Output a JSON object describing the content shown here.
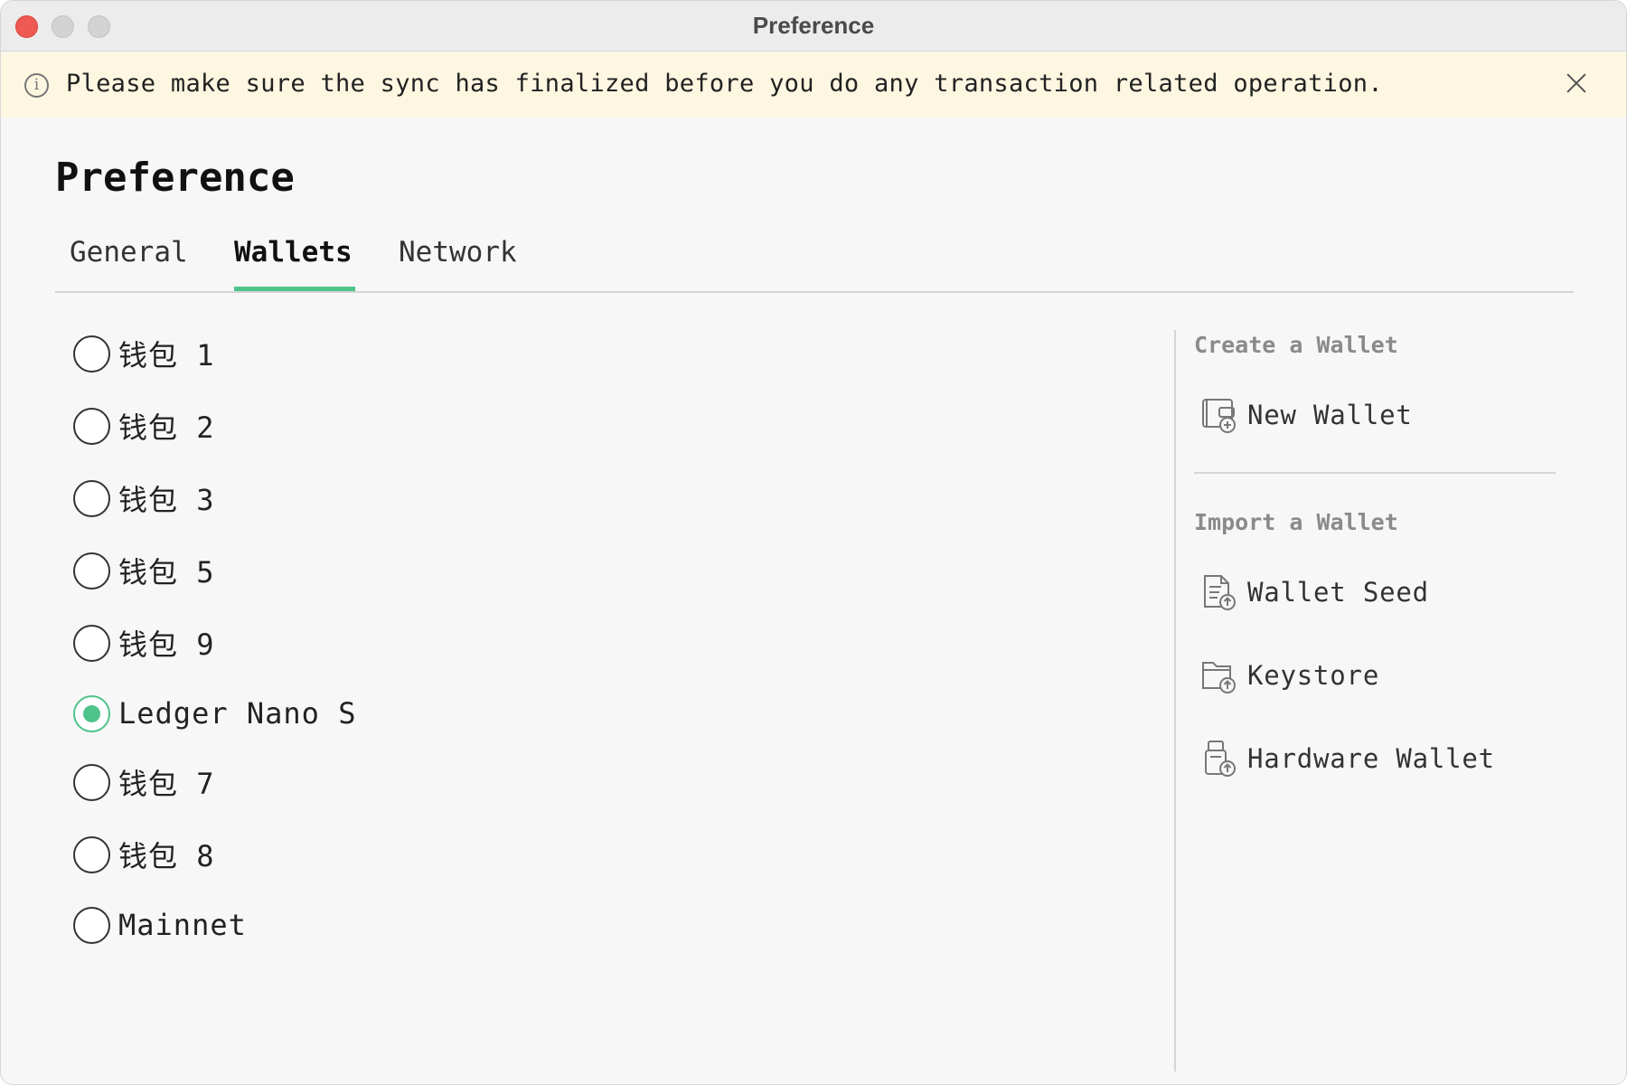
{
  "window": {
    "title": "Preference"
  },
  "banner": {
    "message": "Please make sure the sync has finalized before you do any transaction related operation.",
    "info_icon": "i"
  },
  "page": {
    "title": "Preference"
  },
  "tabs": [
    {
      "label": "General",
      "active": false
    },
    {
      "label": "Wallets",
      "active": true
    },
    {
      "label": "Network",
      "active": false
    }
  ],
  "wallets": [
    {
      "label": "钱包 1",
      "selected": false
    },
    {
      "label": "钱包 2",
      "selected": false
    },
    {
      "label": "钱包 3",
      "selected": false
    },
    {
      "label": "钱包 5",
      "selected": false
    },
    {
      "label": "钱包 9",
      "selected": false
    },
    {
      "label": "Ledger Nano S",
      "selected": true
    },
    {
      "label": "钱包 7",
      "selected": false
    },
    {
      "label": "钱包 8",
      "selected": false
    },
    {
      "label": "Mainnet",
      "selected": false
    }
  ],
  "create_section": {
    "title": "Create a Wallet",
    "actions": [
      {
        "label": "New Wallet",
        "icon": "new-wallet-icon"
      }
    ]
  },
  "import_section": {
    "title": "Import a Wallet",
    "actions": [
      {
        "label": "Wallet Seed",
        "icon": "wallet-seed-icon"
      },
      {
        "label": "Keystore",
        "icon": "keystore-icon"
      },
      {
        "label": "Hardware Wallet",
        "icon": "hardware-wallet-icon"
      }
    ]
  },
  "colors": {
    "accent": "#4ec38a",
    "banner_bg": "#fdf6e1",
    "close_button": "#ee5a52"
  }
}
